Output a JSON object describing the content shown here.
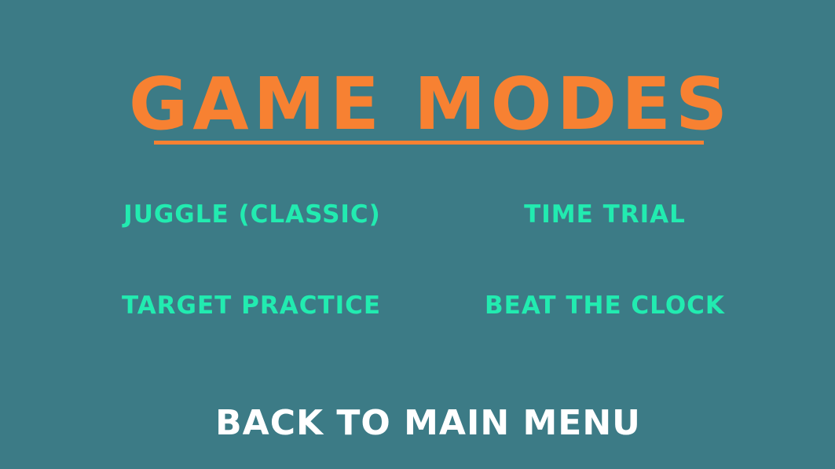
{
  "title": "GAME MODES",
  "modes": [
    {
      "label": "JUGGLE (CLASSIC)"
    },
    {
      "label": "TIME TRIAL"
    },
    {
      "label": "TARGET PRACTICE"
    },
    {
      "label": "BEAT THE CLOCK"
    }
  ],
  "back_label": "BACK TO MAIN MENU",
  "colors": {
    "background": "#3c7b86",
    "title": "#f78132",
    "mode_text": "#22ebb0",
    "back_text": "#ffffff"
  }
}
